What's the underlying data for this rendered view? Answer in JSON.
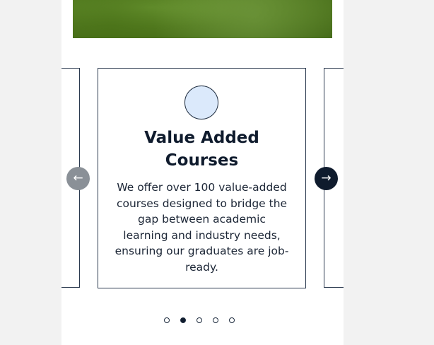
{
  "carousel": {
    "active_card": {
      "icon": "circle-icon",
      "title": "Value Added Courses",
      "description": "We offer over 100 value-added courses designed to bridge the gap between academic learning and industry needs, ensuring our graduates are job-ready."
    },
    "nav": {
      "prev_icon": "←",
      "next_icon": "→"
    },
    "pagination": {
      "total": 5,
      "active_index": 1
    }
  },
  "colors": {
    "accent": "#0f1b2d",
    "icon_fill": "#dbe9fb",
    "prev_button": "#8a9097"
  }
}
